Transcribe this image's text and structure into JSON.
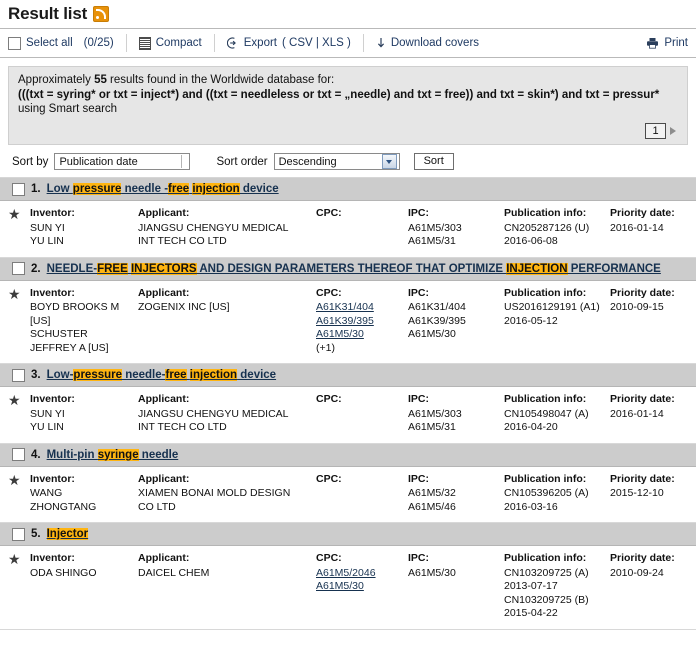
{
  "header": {
    "title": "Result list",
    "rss_icon": "rss-feed-icon"
  },
  "toolbar": {
    "select_all_label": "Select all",
    "select_all_count": "(0/25)",
    "compact_label": "Compact",
    "export_label": "Export",
    "export_formats": "( CSV | XLS )",
    "download_covers_label": "Download covers",
    "print_label": "Print"
  },
  "query_info": {
    "summary_prefix": "Approximately ",
    "summary_count": "55",
    "summary_suffix": " results found in the Worldwide database for:",
    "summary_full": "Approximately 55 results found in the Worldwide database for:",
    "query": "(((txt = syring* or txt = inject*) and ((txt = needleless or txt = „needle) and txt = free)) and txt = skin*) and txt = pressur*",
    "search_mode": "using Smart search",
    "page_number": "1",
    "next_page_icon": "next-page-arrow-icon"
  },
  "sort": {
    "sort_by_label": "Sort by",
    "sort_by_value": "Publication date",
    "sort_order_label": "Sort order",
    "sort_order_value": "Descending",
    "sort_button_label": "Sort"
  },
  "columns": {
    "inventor": "Inventor:",
    "applicant": "Applicant:",
    "cpc": "CPC:",
    "ipc": "IPC:",
    "publication": "Publication info:",
    "priority": "Priority date:"
  },
  "results": [
    {
      "number": "1.",
      "title_parts": [
        {
          "t": "Low ",
          "hl": false
        },
        {
          "t": "pressure",
          "hl": true
        },
        {
          "t": " needle -",
          "hl": false
        },
        {
          "t": "free",
          "hl": true
        },
        {
          "t": " ",
          "hl": false
        },
        {
          "t": "injection",
          "hl": true
        },
        {
          "t": " device",
          "hl": false
        }
      ],
      "title_text": "Low pressure needle -free injection device",
      "inventor": [
        "SUN YI",
        "YU LIN"
      ],
      "applicant": [
        "JIANGSU CHENGYU MEDICAL",
        "INT TECH CO LTD"
      ],
      "cpc": [],
      "ipc": [
        "A61M5/303",
        "A61M5/31"
      ],
      "publication": [
        "CN205287126 (U)",
        "2016-06-08"
      ],
      "priority": [
        "2016-01-14"
      ]
    },
    {
      "number": "2.",
      "title_parts": [
        {
          "t": "NEEDLE-",
          "hl": false
        },
        {
          "t": "FREE",
          "hl": true
        },
        {
          "t": " ",
          "hl": false
        },
        {
          "t": "INJECTORS",
          "hl": true
        },
        {
          "t": " AND DESIGN PARAMETERS THEREOF THAT OPTIMIZE ",
          "hl": false
        },
        {
          "t": "INJECTION",
          "hl": true
        },
        {
          "t": " PERFORMANCE",
          "hl": false
        }
      ],
      "title_text": "NEEDLE-FREE INJECTORS AND DESIGN PARAMETERS THEREOF THAT OPTIMIZE INJECTION PERFORMANCE",
      "inventor": [
        "BOYD BROOKS M",
        "[US]",
        "SCHUSTER",
        "JEFFREY A  [US]"
      ],
      "applicant": [
        "ZOGENIX INC  [US]"
      ],
      "cpc": [
        "A61K31/404",
        "A61K39/395",
        "A61M5/30",
        "(+1)"
      ],
      "ipc": [
        "A61K31/404",
        "A61K39/395",
        "A61M5/30"
      ],
      "publication": [
        "US2016129191 (A1)",
        "2016-05-12"
      ],
      "priority": [
        "2010-09-15"
      ]
    },
    {
      "number": "3.",
      "title_parts": [
        {
          "t": "Low-",
          "hl": false
        },
        {
          "t": "pressure",
          "hl": true
        },
        {
          "t": " needle-",
          "hl": false
        },
        {
          "t": "free",
          "hl": true
        },
        {
          "t": " ",
          "hl": false
        },
        {
          "t": "injection",
          "hl": true
        },
        {
          "t": " device",
          "hl": false
        }
      ],
      "title_text": "Low-pressure needle-free injection device",
      "inventor": [
        "SUN YI",
        "YU LIN"
      ],
      "applicant": [
        "JIANGSU CHENGYU MEDICAL",
        "INT TECH CO LTD"
      ],
      "cpc": [],
      "ipc": [
        "A61M5/303",
        "A61M5/31"
      ],
      "publication": [
        "CN105498047 (A)",
        "2016-04-20"
      ],
      "priority": [
        "2016-01-14"
      ]
    },
    {
      "number": "4.",
      "title_parts": [
        {
          "t": "Multi-pin ",
          "hl": false
        },
        {
          "t": "syringe",
          "hl": true
        },
        {
          "t": " needle",
          "hl": false
        }
      ],
      "title_text": "Multi-pin syringe needle",
      "inventor": [
        "WANG",
        "ZHONGTANG"
      ],
      "applicant": [
        "XIAMEN BONAI MOLD DESIGN",
        "CO LTD"
      ],
      "cpc": [],
      "ipc": [
        "A61M5/32",
        "A61M5/46"
      ],
      "publication": [
        "CN105396205 (A)",
        "2016-03-16"
      ],
      "priority": [
        "2015-12-10"
      ]
    },
    {
      "number": "5.",
      "title_parts": [
        {
          "t": "Injector",
          "hl": true
        }
      ],
      "title_text": "Injector",
      "inventor": [
        "ODA SHINGO"
      ],
      "applicant": [
        "DAICEL CHEM"
      ],
      "cpc": [
        "A61M5/2046",
        "A61M5/30"
      ],
      "ipc": [
        "A61M5/30"
      ],
      "publication": [
        "CN103209725 (A)",
        "2013-07-17",
        "CN103209725 (B)",
        "2015-04-22"
      ],
      "priority": [
        "2010-09-24"
      ]
    }
  ],
  "colors": {
    "highlight": "#ffb511",
    "row_header_bg": "#cccccc",
    "info_bg": "#e6e6e6",
    "link": "#16314f",
    "rss_orange": "#e8920a"
  }
}
